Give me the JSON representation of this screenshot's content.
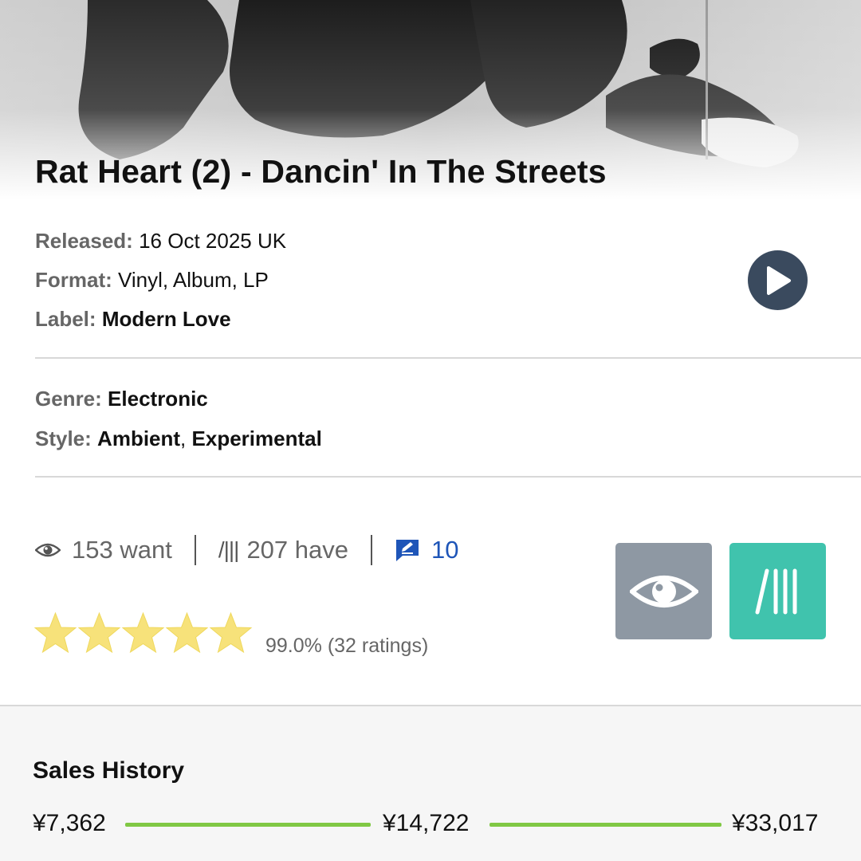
{
  "release": {
    "title": "Rat Heart (2) - Dancin' In The Streets"
  },
  "details": {
    "released_label": "Released:",
    "released_value": "16 Oct 2025 UK",
    "format_label": "Format:",
    "format_value": "Vinyl, Album, LP",
    "label_label": "Label:",
    "label_value": "Modern Love",
    "genre_label": "Genre:",
    "genre_value": "Electronic",
    "style_label": "Style:",
    "style_values": [
      "Ambient",
      "Experimental"
    ],
    "style_separator": ","
  },
  "stats": {
    "want": "153 want",
    "have_glyph": "/|||",
    "have": "207 have",
    "reviews": "10"
  },
  "rating": {
    "stars": 5,
    "text": "99.0% (32 ratings)"
  },
  "actions": {
    "have_glyph": "/|||"
  },
  "sales_history": {
    "title": "Sales History",
    "low": "¥7,362",
    "median": "¥14,722",
    "high": "¥33,017"
  },
  "colors": {
    "play_button": "#3a4a5e",
    "want_button": "#8e98a3",
    "have_button": "#40c3ad",
    "review_link": "#1e55b8",
    "star": "#f7e27a",
    "sales_bar": "#80c844"
  },
  "icons": {
    "play": "play-icon",
    "want": "eye-icon",
    "have": "collection-icon",
    "reviews": "review-edit-icon",
    "star": "star-icon"
  }
}
